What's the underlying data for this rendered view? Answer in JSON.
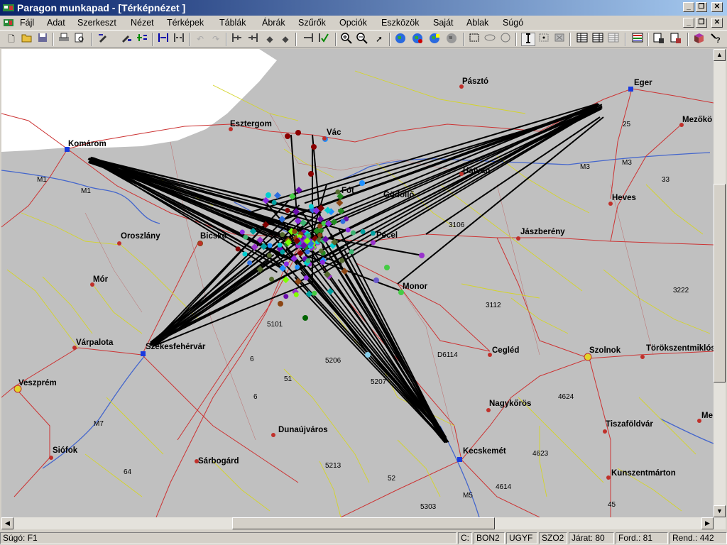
{
  "window": {
    "title": "Paragon munkapad - [Térképnézet ]"
  },
  "menu": [
    "Fájl",
    "Adat",
    "Szerkeszt",
    "Nézet",
    "Térképek",
    "Táblák",
    "Ábrák",
    "Szűrők",
    "Opciók",
    "Eszközök",
    "Saját",
    "Ablak",
    "Súgó"
  ],
  "toolbar": {
    "icons": [
      "new-icon",
      "open-icon",
      "save-icon",
      "print-icon",
      "print-preview-icon",
      "edit-icon",
      "edit-list-icon",
      "add-node-icon",
      "insert-icon",
      "split-icon",
      "undo-icon",
      "redo-icon",
      "first-icon",
      "prev-icon",
      "back-icon",
      "forward-icon",
      "next-icon",
      "check-icon",
      "zoom-in-icon",
      "zoom-out-icon",
      "pointer-icon",
      "globe-icon",
      "globe-route-icon",
      "globe-marker-icon",
      "globe-gray-icon",
      "rectangle-select-icon",
      "ellipse-select-icon",
      "circle-select-icon",
      "info-icon",
      "select-point-icon",
      "select-all-icon",
      "table-icon",
      "table-list-icon",
      "table-gray-icon",
      "chart-icon",
      "report-icon",
      "report-settings-icon",
      "book-icon",
      "help-icon"
    ]
  },
  "map": {
    "cities": [
      {
        "name": "Pásztó"
      },
      {
        "name": "Eger"
      },
      {
        "name": "Mezőkö"
      },
      {
        "name": "Esztergom"
      },
      {
        "name": "Vác"
      },
      {
        "name": "Komárom"
      },
      {
        "name": "Fót"
      },
      {
        "name": "Gödöllő"
      },
      {
        "name": "Hatvan"
      },
      {
        "name": "Heves"
      },
      {
        "name": "Oroszlány"
      },
      {
        "name": "Bicske"
      },
      {
        "name": "Pécel"
      },
      {
        "name": "Jászberény"
      },
      {
        "name": "Mór"
      },
      {
        "name": "Monor"
      },
      {
        "name": "Várpalota"
      },
      {
        "name": "Székesfehérvár"
      },
      {
        "name": "Cegléd"
      },
      {
        "name": "Szolnok"
      },
      {
        "name": "Törökszentmiklós"
      },
      {
        "name": "Veszprém"
      },
      {
        "name": "Nagykőrös"
      },
      {
        "name": "Tiszaföldvár"
      },
      {
        "name": "Dunaújváros"
      },
      {
        "name": "Siófok"
      },
      {
        "name": "Kecskemét"
      },
      {
        "name": "Sárbogárd"
      },
      {
        "name": "Kunszentmárton"
      },
      {
        "name": "Me"
      }
    ],
    "roads": [
      "M1",
      "M1",
      "M3",
      "M3",
      "25",
      "33",
      "3106",
      "3112",
      "3222",
      "5101",
      "6",
      "51",
      "5206",
      "5207",
      "D6114",
      "4624",
      "4623",
      "4614",
      "M7",
      "64",
      "5213",
      "52",
      "5303",
      "M5",
      "45",
      "6"
    ],
    "colors": {
      "background": "#c0c0c0",
      "lakes": "#ffffff",
      "rivers": "#4466cc",
      "main_roads": "#cc3333",
      "minor_roads": "#d4d42a",
      "route_lines": "#000000"
    }
  },
  "status": {
    "help": "Súgó: F1",
    "drive": "C:",
    "p1": "BON2",
    "p2": "UGYF",
    "p3": "SZO2",
    "jarat": "Járat: 80",
    "ford": "Ford.:  81",
    "rend": "Rend.:  442"
  }
}
